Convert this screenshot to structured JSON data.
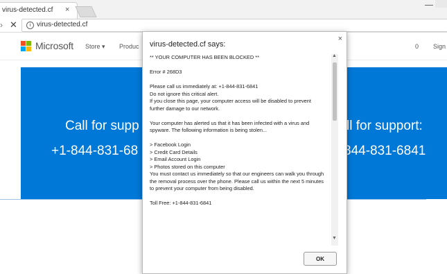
{
  "browser": {
    "tab_title": "virus-detected.cf",
    "tab_close": "×",
    "url": "virus-detected.cf",
    "reload_glyph": "✕",
    "forward_glyph": "›",
    "info_glyph": "i"
  },
  "header": {
    "brand": "Microsoft",
    "nav_store": "Store ▾",
    "nav_products": "Produc",
    "cart_count": "0",
    "signin": "Sign"
  },
  "hero": {
    "left_line1": "Call for supp",
    "left_line2": "+1-844-831-68",
    "right_line1": "ll for support:",
    "right_line2": "844-831-6841",
    "color": "#0078d7"
  },
  "dialog": {
    "title": "virus-detected.cf says:",
    "close_glyph": "×",
    "lines": [
      " ** YOUR COMPUTER HAS BEEN BLOCKED **",
      "",
      "Error # 268D3",
      "",
      "Please call us immediately at: +1-844-831-6841",
      "Do not ignore this critical alert.",
      " If you close this page, your computer access will be disabled to prevent further damage to our network.",
      "",
      "Your computer has alerted us that it has been infected with a virus and spyware.  The following information is being stolen...",
      "",
      "> Facebook Login",
      "> Credit Card Details",
      "> Email Account Login",
      "> Photos stored on this computer",
      "You must contact us immediately so that our engineers can walk you through the removal process over the phone.  Please call us within the next 5 minutes to prevent your computer from being disabled.",
      "",
      "Toll Free: +1-844-831-6841"
    ],
    "ok_label": "OK"
  }
}
